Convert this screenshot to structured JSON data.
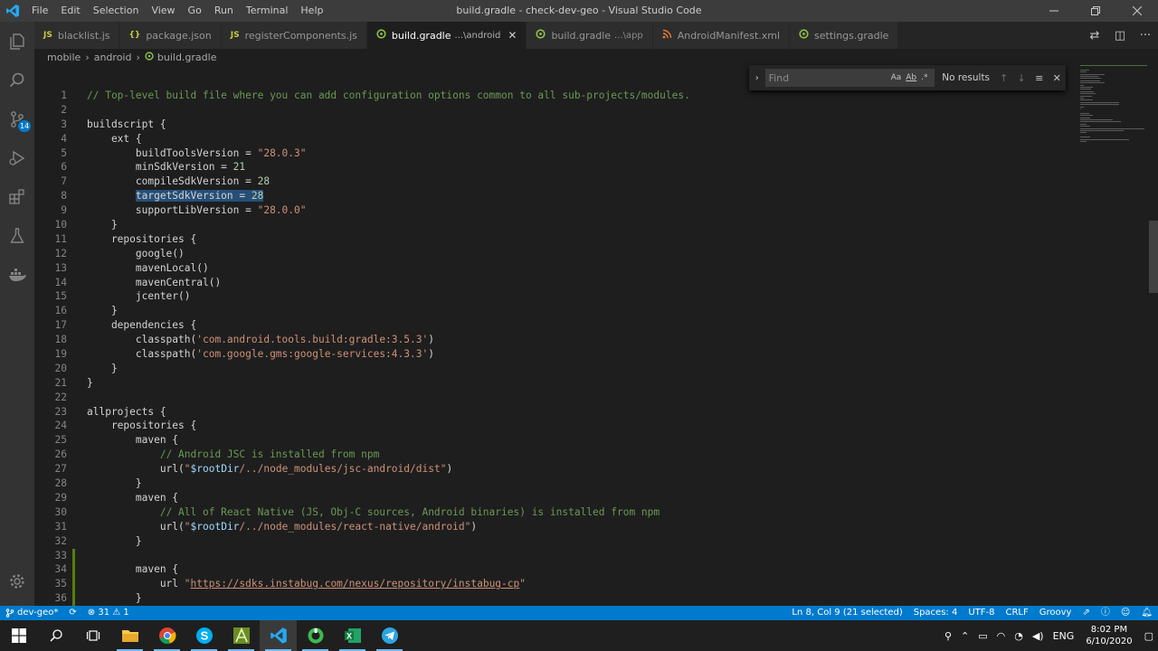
{
  "window": {
    "title": "build.gradle - check-dev-geo - Visual Studio Code",
    "menu": [
      "File",
      "Edit",
      "Selection",
      "View",
      "Go",
      "Run",
      "Terminal",
      "Help"
    ]
  },
  "activity_bar": {
    "source_control_badge": "14"
  },
  "tabs": [
    {
      "icon": "JS",
      "label": "blacklist.js",
      "desc": ""
    },
    {
      "icon": "{}",
      "label": "package.json",
      "desc": ""
    },
    {
      "icon": "JS",
      "label": "registerComponents.js",
      "desc": ""
    },
    {
      "icon": "G",
      "label": "build.gradle",
      "desc": "...\\android"
    },
    {
      "icon": "G",
      "label": "build.gradle",
      "desc": "...\\app"
    },
    {
      "icon": "RSS",
      "label": "AndroidManifest.xml",
      "desc": ""
    },
    {
      "icon": "G",
      "label": "settings.gradle",
      "desc": ""
    }
  ],
  "breadcrumb": [
    "mobile",
    "android",
    "build.gradle"
  ],
  "find": {
    "placeholder": "Find",
    "match_case": "Aa",
    "whole_word": "Ab",
    "regex": ".*",
    "result": "No results"
  },
  "code_lines": [
    {
      "n": "1",
      "t": [
        [
          "comment",
          "// Top-level build file where you can add configuration options common to all sub-projects/modules."
        ]
      ]
    },
    {
      "n": "2",
      "t": []
    },
    {
      "n": "3",
      "t": [
        [
          "plain",
          "buildscript {"
        ]
      ]
    },
    {
      "n": "4",
      "t": [
        [
          "plain",
          "    ext {"
        ]
      ]
    },
    {
      "n": "5",
      "t": [
        [
          "plain",
          "        buildToolsVersion = "
        ],
        [
          "string",
          "\"28.0.3\""
        ]
      ]
    },
    {
      "n": "6",
      "t": [
        [
          "plain",
          "        minSdkVersion = "
        ],
        [
          "number",
          "21"
        ]
      ]
    },
    {
      "n": "7",
      "t": [
        [
          "plain",
          "        compileSdkVersion = "
        ],
        [
          "number",
          "28"
        ]
      ]
    },
    {
      "n": "8",
      "t": [
        [
          "plain",
          "        "
        ],
        [
          "sel",
          "targetSdkVersion = "
        ],
        [
          "selnum",
          "28"
        ]
      ]
    },
    {
      "n": "9",
      "t": [
        [
          "plain",
          "        supportLibVersion = "
        ],
        [
          "string",
          "\"28.0.0\""
        ]
      ]
    },
    {
      "n": "10",
      "t": [
        [
          "plain",
          "    }"
        ]
      ]
    },
    {
      "n": "11",
      "t": [
        [
          "plain",
          "    repositories {"
        ]
      ]
    },
    {
      "n": "12",
      "t": [
        [
          "plain",
          "        google()"
        ]
      ]
    },
    {
      "n": "13",
      "t": [
        [
          "plain",
          "        mavenLocal()"
        ]
      ]
    },
    {
      "n": "14",
      "t": [
        [
          "plain",
          "        mavenCentral()"
        ]
      ]
    },
    {
      "n": "15",
      "t": [
        [
          "plain",
          "        jcenter()"
        ]
      ]
    },
    {
      "n": "16",
      "t": [
        [
          "plain",
          "    }"
        ]
      ]
    },
    {
      "n": "17",
      "t": [
        [
          "plain",
          "    dependencies {"
        ]
      ]
    },
    {
      "n": "18",
      "t": [
        [
          "plain",
          "        classpath("
        ],
        [
          "string",
          "'com.android.tools.build:gradle:3.5.3'"
        ],
        [
          "plain",
          ")"
        ]
      ]
    },
    {
      "n": "19",
      "t": [
        [
          "plain",
          "        classpath("
        ],
        [
          "string",
          "'com.google.gms:google-services:4.3.3'"
        ],
        [
          "plain",
          ")"
        ]
      ]
    },
    {
      "n": "20",
      "t": [
        [
          "plain",
          "    }"
        ]
      ]
    },
    {
      "n": "21",
      "t": [
        [
          "plain",
          "}"
        ]
      ]
    },
    {
      "n": "22",
      "t": []
    },
    {
      "n": "23",
      "t": [
        [
          "plain",
          "allprojects {"
        ]
      ]
    },
    {
      "n": "24",
      "t": [
        [
          "plain",
          "    repositories {"
        ]
      ]
    },
    {
      "n": "25",
      "t": [
        [
          "plain",
          "        maven {"
        ]
      ]
    },
    {
      "n": "26",
      "t": [
        [
          "plain",
          "            "
        ],
        [
          "comment",
          "// Android JSC is installed from npm"
        ]
      ]
    },
    {
      "n": "27",
      "t": [
        [
          "plain",
          "            url("
        ],
        [
          "string",
          "\""
        ],
        [
          "var",
          "$rootDir"
        ],
        [
          "string",
          "/../node_modules/jsc-android/dist\""
        ],
        [
          "plain",
          ")"
        ]
      ]
    },
    {
      "n": "28",
      "t": [
        [
          "plain",
          "        }"
        ]
      ]
    },
    {
      "n": "29",
      "t": [
        [
          "plain",
          "        maven {"
        ]
      ]
    },
    {
      "n": "30",
      "t": [
        [
          "plain",
          "            "
        ],
        [
          "comment",
          "// All of React Native (JS, Obj-C sources, Android binaries) is installed from npm"
        ]
      ]
    },
    {
      "n": "31",
      "t": [
        [
          "plain",
          "            url("
        ],
        [
          "string",
          "\""
        ],
        [
          "var",
          "$rootDir"
        ],
        [
          "string",
          "/../node_modules/react-native/android\""
        ],
        [
          "plain",
          ")"
        ]
      ]
    },
    {
      "n": "32",
      "t": [
        [
          "plain",
          "        }"
        ]
      ]
    },
    {
      "n": "33",
      "t": [],
      "mod": true
    },
    {
      "n": "34",
      "t": [
        [
          "plain",
          "        maven {"
        ]
      ],
      "mod": true
    },
    {
      "n": "35",
      "t": [
        [
          "plain",
          "            url "
        ],
        [
          "string",
          "\""
        ],
        [
          "link",
          "https://sdks.instabug.com/nexus/repository/instabug-cp"
        ],
        [
          "string",
          "\""
        ]
      ],
      "mod": true
    },
    {
      "n": "36",
      "t": [
        [
          "plain",
          "        }"
        ]
      ],
      "mod": true
    }
  ],
  "status": {
    "branch": "dev-geo*",
    "problems_errors": "31",
    "problems_warnings": "1",
    "cursor": "Ln 8, Col 9 (21 selected)",
    "indent": "Spaces: 4",
    "encoding": "UTF-8",
    "eol": "CRLF",
    "language": "Groovy"
  },
  "taskbar": {
    "lang": "ENG",
    "time": "8:02 PM",
    "date": "6/10/2020"
  },
  "colors": {
    "accent": "#007acc",
    "selection": "#264f78",
    "comment": "#6a9955",
    "string": "#ce9178",
    "number": "#b5cea8"
  }
}
